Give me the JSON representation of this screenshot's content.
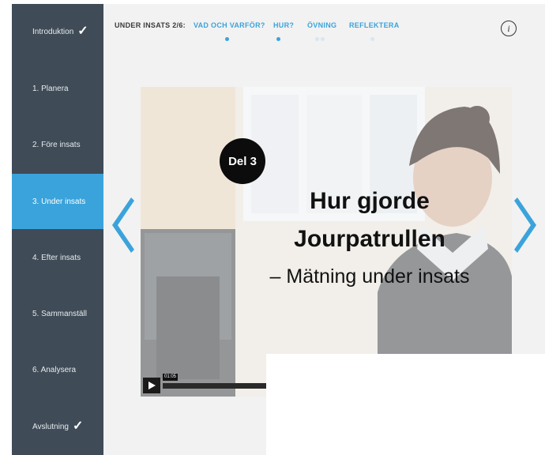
{
  "sidebar": {
    "items": [
      {
        "label": "Introduktion",
        "checked": true,
        "active": false
      },
      {
        "label": "1. Planera",
        "checked": false,
        "active": false
      },
      {
        "label": "2. Före insats",
        "checked": false,
        "active": false
      },
      {
        "label": "3. Under insats",
        "checked": false,
        "active": true
      },
      {
        "label": "4. Efter insats",
        "checked": false,
        "active": false
      },
      {
        "label": "5. Sammanställ",
        "checked": false,
        "active": false
      },
      {
        "label": "6. Analysera",
        "checked": false,
        "active": false
      },
      {
        "label": "Avslutning",
        "checked": true,
        "active": false
      }
    ],
    "check_glyph": "✓"
  },
  "topnav": {
    "step_label": "UNDER INSATS 2/6:",
    "tabs": [
      {
        "label": "VAD OCH VARFÖR?"
      },
      {
        "label": "HUR?"
      },
      {
        "label": "ÖVNING"
      },
      {
        "label": "REFLEKTERA"
      }
    ],
    "info_icon": "i"
  },
  "video": {
    "badge": "Del 3",
    "title_line1": "Hur gjorde",
    "title_line2": "Jourpatrullen",
    "subtitle": "– Mätning under insats",
    "time": "01:05"
  },
  "colors": {
    "sidebar_bg": "#3f4b57",
    "accent": "#3ba3db",
    "content_bg": "#f2f2f2"
  },
  "icons": {
    "prev": "chevron-left-icon",
    "next": "chevron-right-icon",
    "play": "play-icon",
    "info": "info-icon",
    "check": "check-icon"
  }
}
